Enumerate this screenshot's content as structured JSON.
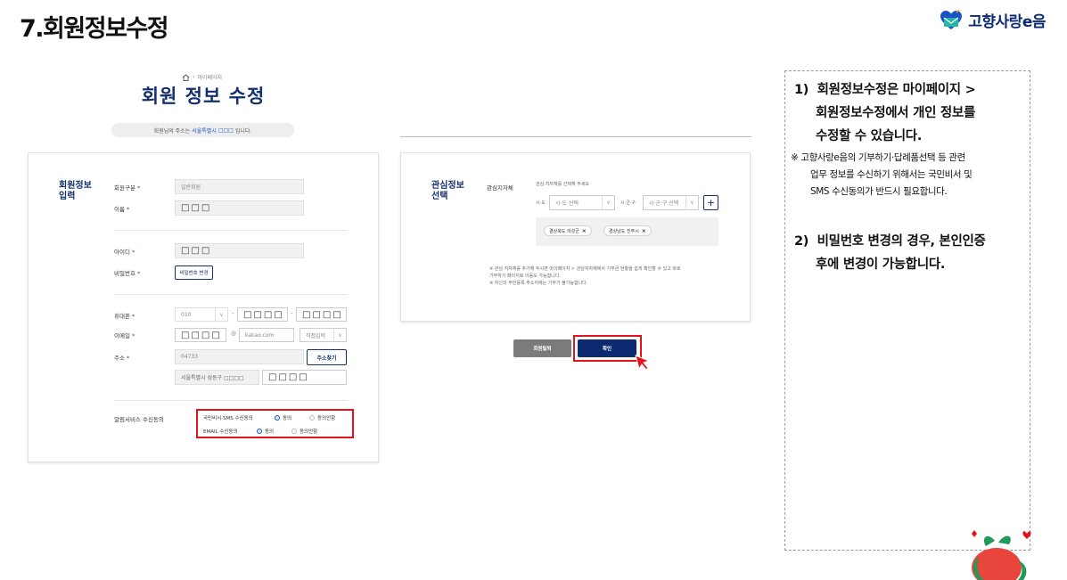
{
  "slide": {
    "title": "7.회원정보수정",
    "logo_text": "고향사랑e음"
  },
  "colors": {
    "navy": "#13306b",
    "accent_blue": "#1a53c6",
    "highlight_red": "#e3131a"
  },
  "breadcrumb": {
    "icon": "home-icon",
    "label": "마이페이지"
  },
  "page": {
    "title": "회원 정보 수정",
    "address_notice": {
      "prefix": "회원님의 주소는",
      "highlight": "서울특별시",
      "masked": "□□□",
      "suffix": "입니다."
    }
  },
  "member_form": {
    "section_label_1": "회원정보",
    "section_label_2": "입력",
    "member_type": {
      "label": "회원구분",
      "required": "*",
      "value": "일반회원"
    },
    "name": {
      "label": "이름",
      "required": "*",
      "value": "□□□"
    },
    "user_id": {
      "label": "아이디",
      "required": "*",
      "value": "□□□"
    },
    "password": {
      "label": "비밀번호",
      "required": "*",
      "button": "비밀번호 변경"
    },
    "phone": {
      "label": "휴대폰",
      "required": "*",
      "prefix": "010",
      "dash": "-",
      "middle": "□□□□",
      "last": "□□□□"
    },
    "email": {
      "label": "이메일",
      "required": "*",
      "local": "□□□□",
      "at": "@",
      "domain": "kakao.com",
      "direct": "직접입력"
    },
    "address": {
      "label": "주소",
      "required": "*",
      "zipcode": "04733",
      "search_button": "주소찾기",
      "line1": "서울특별시 성동구 □□□□",
      "line2": "□□□□"
    },
    "notification": {
      "label": "알림서비스 수신동의",
      "sms": {
        "label": "국민비서·SMS 수신동의",
        "agree": "동의",
        "disagree": "동의안함",
        "selected": "agree"
      },
      "email": {
        "label": "EMAIL 수신동의",
        "agree": "동의",
        "disagree": "동의안함",
        "selected": "agree"
      }
    }
  },
  "interest_form": {
    "section_label_1": "관심정보",
    "section_label_2": "선택",
    "field_label": "관심지자체",
    "hint": "관심 지자체를 선택해 주세요",
    "sido_label": "시·도",
    "sido_placeholder": "시·도 선택",
    "sigungu_label": "시·군·구",
    "sigungu_placeholder": "시·군·구 선택",
    "chips": [
      "경상북도 의성군",
      "경상남도 진주시"
    ],
    "note_1": "※ 관심 지자체를 추가해 두시면 마이페이지 > 관심지자체에서 기부금 현황을 쉽게 확인할 수 있고 바로",
    "note_2": "기부하기 페이지로 이동도 가능합니다.",
    "note_3": "※ 자신의 주민등록 주소지에는 기부가 불가능합니다."
  },
  "actions": {
    "withdraw": "회원탈퇴",
    "confirm": "확인"
  },
  "explanation": {
    "item1_num": "1)",
    "item1_line1": "회원정보수정은 마이페이지 >",
    "item1_line2": "회원정보수정에서 개인 정보를",
    "item1_line3": "수정할 수 있습니다.",
    "note_line1": "※ 고향사랑e음의 기부하기·답례품선택 등 관련",
    "note_line2": "업무 정보를 수신하기 위해서는 국민비서 및",
    "note_line3": "SMS 수신동의가 반드시 필요합니다.",
    "item2_num": "2)",
    "item2_line1": "비밀번호 변경의 경우, 본인인증",
    "item2_line2": "후에 변경이 가능합니다."
  }
}
